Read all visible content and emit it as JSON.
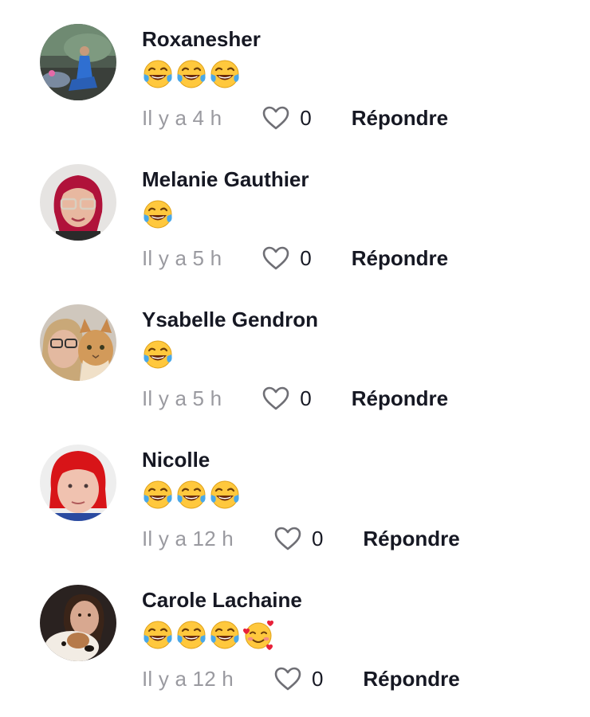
{
  "comments": [
    {
      "username": "Roxanesher",
      "content": "😂😂😂",
      "emojis": [
        "face-with-tears-of-joy",
        "face-with-tears-of-joy",
        "face-with-tears-of-joy"
      ],
      "timestamp": "Il y a 4 h",
      "likes": "0",
      "reply_label": "Répondre",
      "avatar_icon": "outdoor-photo-avatar"
    },
    {
      "username": "Melanie Gauthier",
      "content": "😂",
      "emojis": [
        "face-with-tears-of-joy"
      ],
      "timestamp": "Il y a 5 h",
      "likes": "0",
      "reply_label": "Répondre",
      "avatar_icon": "portrait-red-hair-glasses-avatar"
    },
    {
      "username": "Ysabelle Gendron",
      "content": "😂",
      "emojis": [
        "face-with-tears-of-joy"
      ],
      "timestamp": "Il y a 5 h",
      "likes": "0",
      "reply_label": "Répondre",
      "avatar_icon": "portrait-with-cat-avatar"
    },
    {
      "username": "Nicolle",
      "content": "😂😂😂",
      "emojis": [
        "face-with-tears-of-joy",
        "face-with-tears-of-joy",
        "face-with-tears-of-joy"
      ],
      "timestamp": "Il y a 12 h",
      "likes": "0",
      "reply_label": "Répondre",
      "avatar_icon": "portrait-red-hair-avatar"
    },
    {
      "username": "Carole Lachaine",
      "content": "😂😂😂🥰",
      "emojis": [
        "face-with-tears-of-joy",
        "face-with-tears-of-joy",
        "face-with-tears-of-joy",
        "smiling-face-with-hearts"
      ],
      "timestamp": "Il y a 12 h",
      "likes": "0",
      "reply_label": "Répondre",
      "avatar_icon": "portrait-with-dog-avatar"
    }
  ],
  "colors": {
    "text_primary": "#161823",
    "text_secondary": "#9a9aa0",
    "heart_outline": "#6f6f75",
    "emoji_yellow": "#ffc83d",
    "emoji_tears": "#4aa8e8"
  }
}
